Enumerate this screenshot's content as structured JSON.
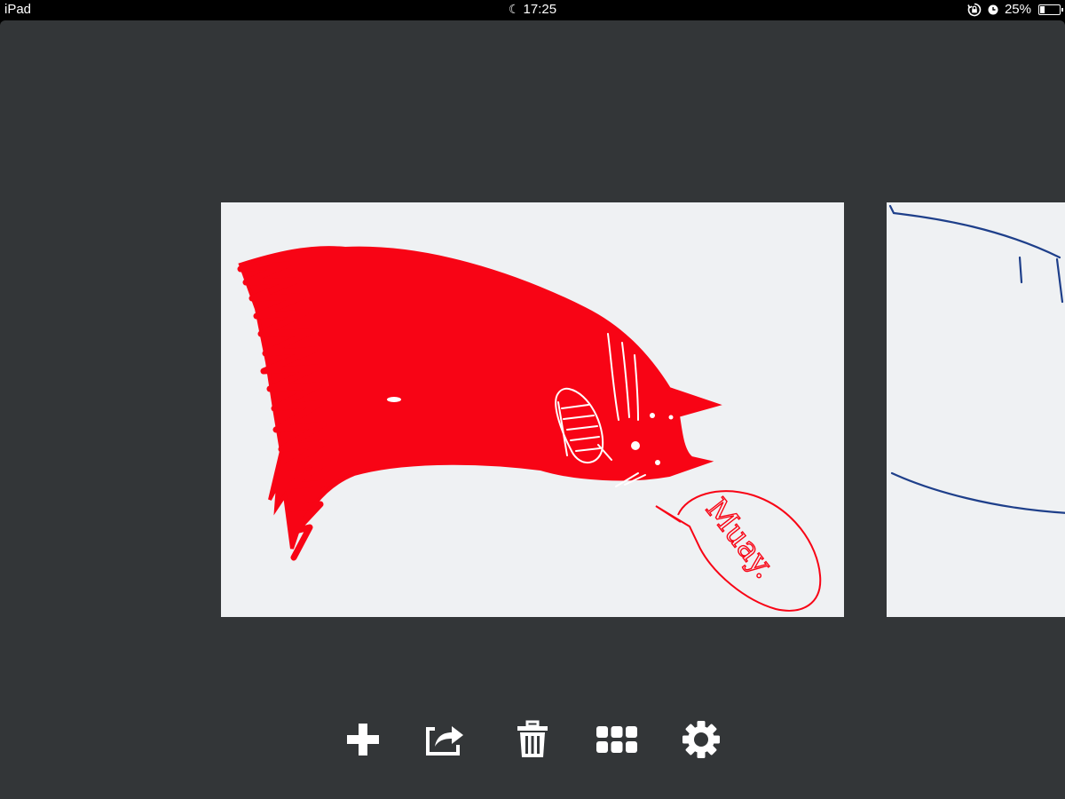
{
  "status_bar": {
    "device": "iPad",
    "time": "17:25",
    "battery_text": "25%",
    "battery_level": 0.25,
    "icons": [
      "moon-icon",
      "rotation-lock-icon",
      "alarm-clock-icon",
      "battery-icon"
    ]
  },
  "gallery": {
    "current_drawing": {
      "speech_bubble_text": "Muay.",
      "ink_color": "#f80415",
      "paper_color": "#eff1f3"
    },
    "next_drawing": {
      "ink_color": "#1e3f8a"
    }
  },
  "toolbar": {
    "items": [
      {
        "name": "new-drawing",
        "icon": "plus-icon"
      },
      {
        "name": "share",
        "icon": "share-icon"
      },
      {
        "name": "delete",
        "icon": "trash-icon"
      },
      {
        "name": "gallery-grid",
        "icon": "grid-icon"
      },
      {
        "name": "settings",
        "icon": "gear-icon"
      }
    ]
  },
  "colors": {
    "background": "#333638",
    "icon": "#ffffff"
  }
}
